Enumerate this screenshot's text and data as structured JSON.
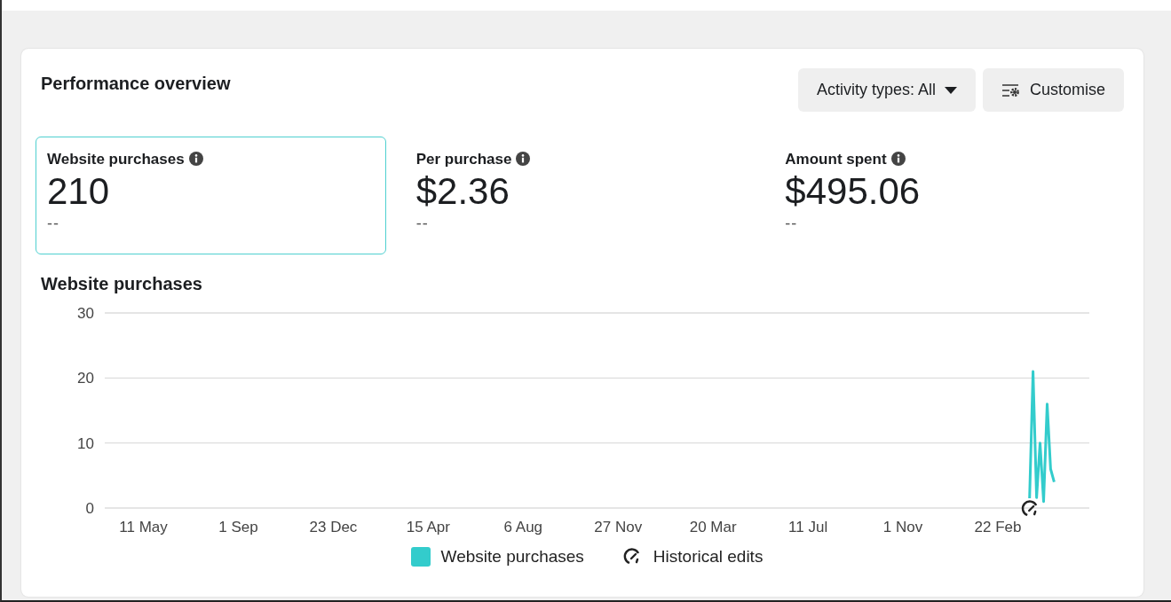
{
  "card": {
    "title": "Performance overview",
    "buttons": [
      {
        "kind": "dropdown",
        "label": "Activity types: All"
      },
      {
        "kind": "customise",
        "label": "Customise"
      }
    ],
    "metrics": [
      {
        "label": "Website purchases",
        "value": "210",
        "comparison": "--",
        "selected": true
      },
      {
        "label": "Per purchase",
        "value": "$2.36",
        "comparison": "--",
        "selected": false
      },
      {
        "label": "Amount spent",
        "value": "$495.06",
        "comparison": "--",
        "selected": false
      }
    ],
    "chart_title": "Website purchases",
    "chart_data": {
      "type": "line",
      "ylim": [
        0,
        30
      ],
      "yticks": [
        0,
        10,
        20,
        30
      ],
      "categories": [
        null,
        null,
        null,
        null,
        null,
        null,
        null,
        null,
        null,
        null,
        null,
        "11 May",
        null,
        null,
        null,
        null,
        null,
        null,
        null,
        null,
        null,
        null,
        null,
        null,
        null,
        null,
        null,
        null,
        null,
        null,
        null,
        null,
        null,
        null,
        null,
        null,
        null,
        null,
        "1 Sep",
        null,
        null,
        null,
        null,
        null,
        null,
        null,
        null,
        null,
        null,
        null,
        null,
        null,
        null,
        null,
        null,
        null,
        null,
        null,
        null,
        null,
        null,
        null,
        null,
        null,
        null,
        "23 Dec",
        null,
        null,
        null,
        null,
        null,
        null,
        null,
        null,
        null,
        null,
        null,
        null,
        null,
        null,
        null,
        null,
        null,
        null,
        null,
        null,
        null,
        null,
        null,
        null,
        null,
        null,
        "15 Apr",
        null,
        null,
        null,
        null,
        null,
        null,
        null,
        null,
        null,
        null,
        null,
        null,
        null,
        null,
        null,
        null,
        null,
        null,
        null,
        null,
        null,
        null,
        null,
        null,
        null,
        null,
        "6 Aug",
        null,
        null,
        null,
        null,
        null,
        null,
        null,
        null,
        null,
        null,
        null,
        null,
        null,
        null,
        null,
        null,
        null,
        null,
        null,
        null,
        null,
        null,
        null,
        null,
        null,
        null,
        "27 Nov",
        null,
        null,
        null,
        null,
        null,
        null,
        null,
        null,
        null,
        null,
        null,
        null,
        null,
        null,
        null,
        null,
        null,
        null,
        null,
        null,
        null,
        null,
        null,
        null,
        null,
        null,
        "20 Mar",
        null,
        null,
        null,
        null,
        null,
        null,
        null,
        null,
        null,
        null,
        null,
        null,
        null,
        null,
        null,
        null,
        null,
        null,
        null,
        null,
        null,
        null,
        null,
        null,
        null,
        null,
        "11 Jul",
        null,
        null,
        null,
        null,
        null,
        null,
        null,
        null,
        null,
        null,
        null,
        null,
        null,
        null,
        null,
        null,
        null,
        null,
        null,
        null,
        null,
        null,
        null,
        null,
        null,
        null,
        "1 Nov",
        null,
        null,
        null,
        null,
        null,
        null,
        null,
        null,
        null,
        null,
        null,
        null,
        null,
        null,
        null,
        null,
        null,
        null,
        null,
        null,
        null,
        null,
        null,
        null,
        null,
        null,
        "22 Feb",
        null,
        null,
        null,
        null,
        null,
        null,
        null,
        null,
        null,
        null,
        null,
        null,
        null,
        null,
        null,
        null,
        null,
        null,
        null,
        null,
        null,
        null,
        null,
        null,
        null,
        null
      ],
      "series": [
        {
          "name": "Website purchases",
          "color": "#33cccc",
          "values": [
            null,
            null,
            null,
            null,
            null,
            null,
            null,
            null,
            null,
            null,
            null,
            null,
            null,
            null,
            null,
            null,
            null,
            null,
            null,
            null,
            null,
            null,
            null,
            null,
            null,
            null,
            null,
            null,
            null,
            null,
            null,
            null,
            null,
            null,
            null,
            null,
            null,
            null,
            null,
            null,
            null,
            null,
            null,
            null,
            null,
            null,
            null,
            null,
            null,
            null,
            null,
            null,
            null,
            null,
            null,
            null,
            null,
            null,
            null,
            null,
            null,
            null,
            null,
            null,
            null,
            null,
            null,
            null,
            null,
            null,
            null,
            null,
            null,
            null,
            null,
            null,
            null,
            null,
            null,
            null,
            null,
            null,
            null,
            null,
            null,
            null,
            null,
            null,
            null,
            null,
            null,
            null,
            null,
            null,
            null,
            null,
            null,
            null,
            null,
            null,
            null,
            null,
            null,
            null,
            null,
            null,
            null,
            null,
            null,
            null,
            null,
            null,
            null,
            null,
            null,
            null,
            null,
            null,
            null,
            null,
            null,
            null,
            null,
            null,
            null,
            null,
            null,
            null,
            null,
            null,
            null,
            null,
            null,
            null,
            null,
            null,
            null,
            null,
            null,
            null,
            null,
            null,
            null,
            null,
            null,
            null,
            null,
            null,
            null,
            null,
            null,
            null,
            null,
            null,
            null,
            null,
            null,
            null,
            null,
            null,
            null,
            null,
            null,
            null,
            null,
            null,
            null,
            null,
            null,
            null,
            null,
            null,
            null,
            null,
            null,
            null,
            null,
            null,
            null,
            null,
            null,
            null,
            null,
            null,
            null,
            null,
            null,
            null,
            null,
            null,
            null,
            null,
            null,
            null,
            null,
            null,
            null,
            null,
            null,
            null,
            null,
            null,
            null,
            null,
            null,
            null,
            null,
            null,
            null,
            null,
            null,
            null,
            null,
            null,
            null,
            null,
            null,
            null,
            null,
            null,
            null,
            null,
            null,
            null,
            null,
            null,
            null,
            null,
            null,
            null,
            null,
            null,
            null,
            null,
            null,
            null,
            null,
            null,
            null,
            null,
            null,
            null,
            null,
            null,
            null,
            null,
            null,
            null,
            null,
            null,
            null,
            null,
            null,
            null,
            null,
            null,
            null,
            null,
            null,
            null,
            null,
            null,
            null,
            1.5,
            21,
            1.6,
            10,
            1,
            16,
            6,
            4,
            null,
            null,
            null,
            null,
            null,
            null,
            null,
            null,
            null,
            null
          ]
        }
      ]
    },
    "legend": [
      {
        "kind": "edits",
        "label": "Historical edits"
      }
    ]
  }
}
